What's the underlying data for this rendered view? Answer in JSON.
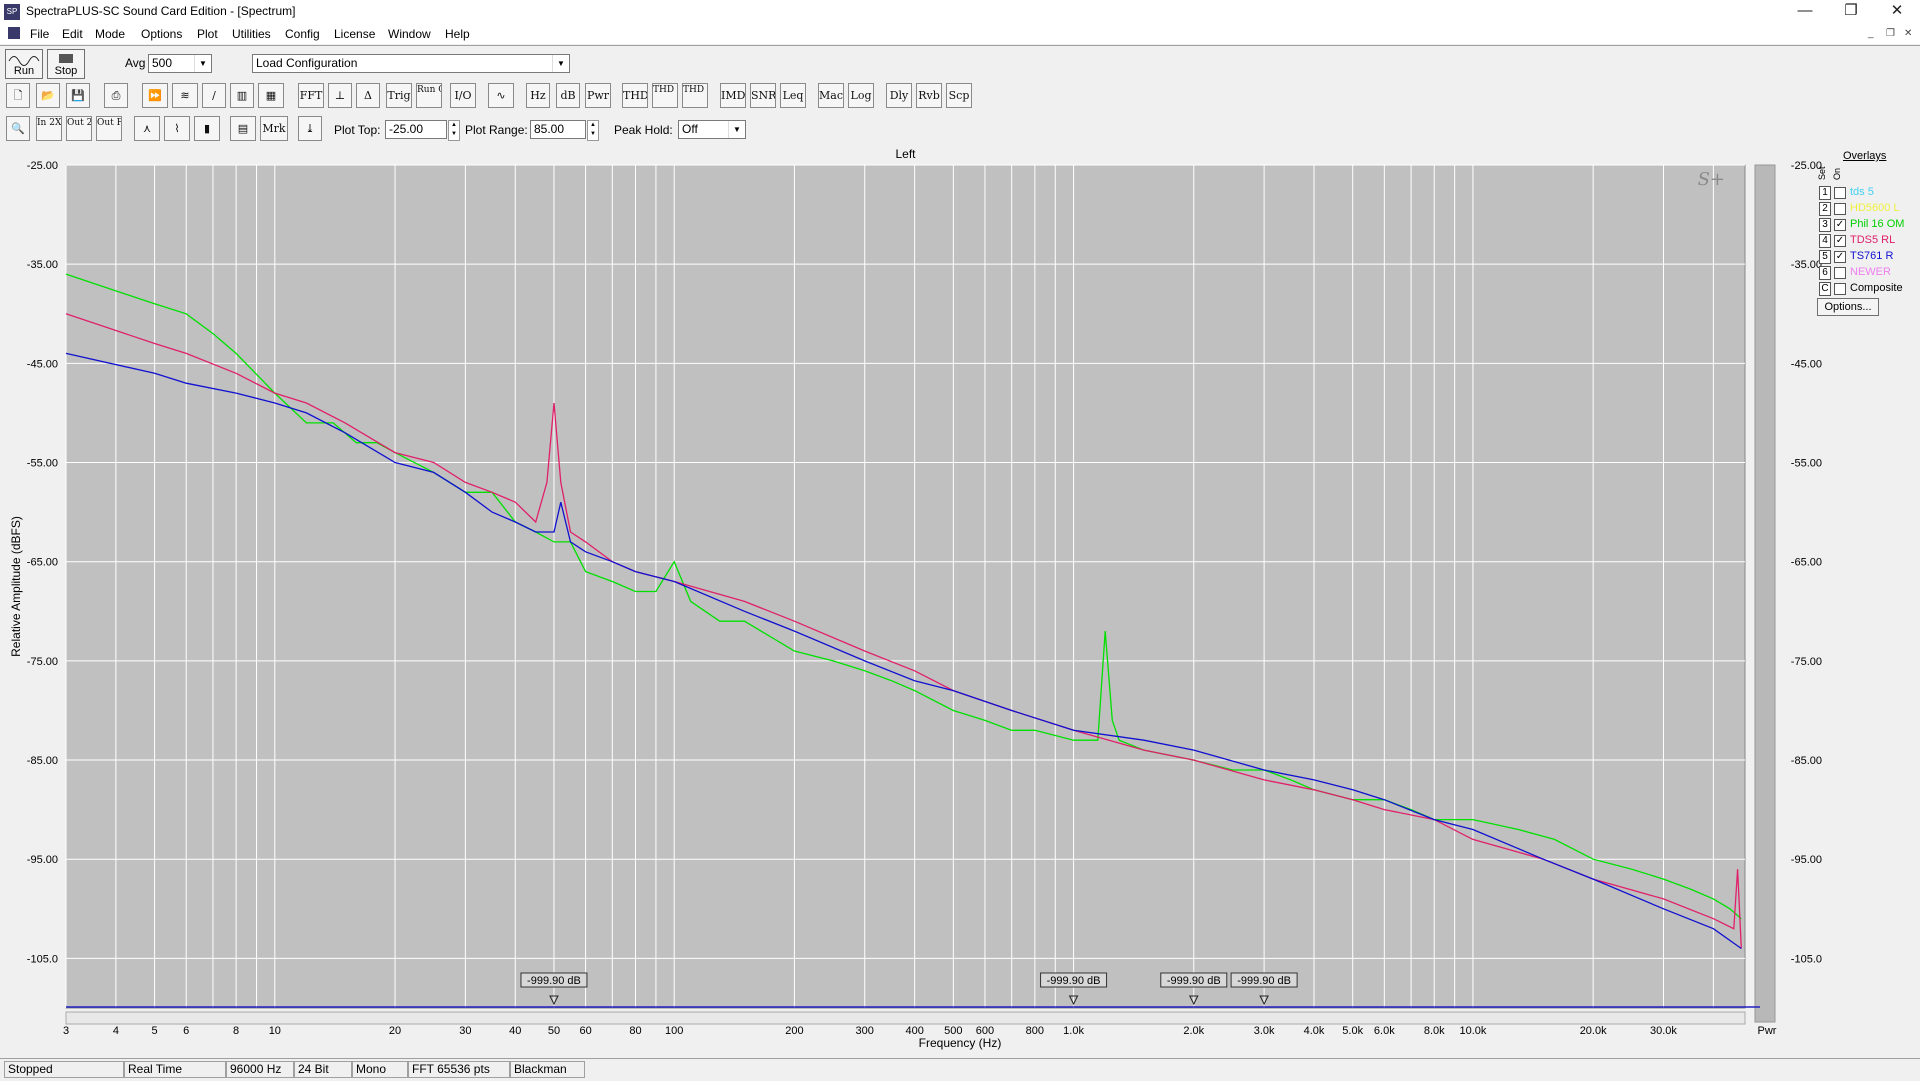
{
  "window": {
    "title": "SpectraPLUS-SC Sound Card Edition - [Spectrum]",
    "app_icon_text": "SP",
    "minimize": "—",
    "restore": "❐",
    "close": "✕"
  },
  "menu": [
    "File",
    "Edit",
    "Mode",
    "Options",
    "Plot",
    "Utilities",
    "Config",
    "License",
    "Window",
    "Help"
  ],
  "mdi_controls": [
    "_",
    "❐",
    "✕"
  ],
  "toolbar": {
    "run_label": "Run",
    "stop_label": "Stop",
    "avg_label": "Avg",
    "avg_value": "500",
    "config_value": "Load Configuration",
    "plot_top_label": "Plot Top:",
    "plot_top_value": "-25.00",
    "plot_range_label": "Plot Range:",
    "plot_range_value": "85.00",
    "peak_hold_label": "Peak Hold:",
    "peak_hold_value": "Off",
    "row2_buttons": [
      "FFT",
      "Trig",
      "Run Ctrl",
      "I/O",
      "Hz",
      "dB",
      "Pwr",
      "THD",
      "THD +N",
      "THD Freq",
      "IMD",
      "SNR",
      "Leq",
      "Mac",
      "Log",
      "Dly",
      "Rvb",
      "Scp"
    ],
    "row3_buttons": [
      "Mrk"
    ],
    "zoom_buttons": [
      "In 2X",
      "Out 2X",
      "Out Full"
    ]
  },
  "plot": {
    "channel_title": "Left",
    "watermark": "S+",
    "y_axis_label": "Relative Amplitude (dBFS)",
    "x_axis_label": "Frequency (Hz)",
    "right_axis_unit": "Pwr",
    "y_ticks": [
      "-25.00",
      "-35.00",
      "-45.00",
      "-55.00",
      "-65.00",
      "-75.00",
      "-85.00",
      "-95.00",
      "-105.0"
    ],
    "x_ticks": [
      "3",
      "4",
      "5",
      "6",
      "8",
      "10",
      "20",
      "30",
      "40",
      "50",
      "60",
      "80",
      "100",
      "200",
      "300",
      "400",
      "500",
      "600",
      "800",
      "1.0k",
      "2.0k",
      "3.0k",
      "4.0k",
      "5.0k",
      "6.0k",
      "8.0k",
      "10.0k",
      "20.0k",
      "30.0k"
    ],
    "markers": [
      "-999.90 dB",
      "-999.90 dB",
      "-999.90 dB",
      "-999.90 dB"
    ],
    "colors": {
      "plot_bg": "#c0c0c0",
      "grid": "#ffffff",
      "green": "#00e000",
      "pink": "#e0206a",
      "blue": "#1010d0"
    }
  },
  "overlays": {
    "header": "Overlays",
    "set_label": "Set",
    "on_label": "On",
    "items": [
      {
        "num": "1",
        "name": "tds 5",
        "checked": false,
        "color": "#40d0f0"
      },
      {
        "num": "2",
        "name": "HD5600 L",
        "checked": false,
        "color": "#f0f040"
      },
      {
        "num": "3",
        "name": "Phil 16 OM",
        "checked": true,
        "color": "#00d000"
      },
      {
        "num": "4",
        "name": "TDS5 RL",
        "checked": true,
        "color": "#e0206a"
      },
      {
        "num": "5",
        "name": "TS761 R",
        "checked": true,
        "color": "#1010d0"
      },
      {
        "num": "6",
        "name": "NEWER",
        "checked": false,
        "color": "#f080f0"
      },
      {
        "num": "C",
        "name": "Composite",
        "checked": false,
        "color": "#000000"
      }
    ],
    "options_label": "Options..."
  },
  "chart_data": {
    "type": "line",
    "title": "Left",
    "xlabel": "Frequency (Hz)",
    "ylabel": "Relative Amplitude (dBFS)",
    "x_scale": "log",
    "xlim": [
      3,
      48000
    ],
    "ylim": [
      -110,
      -25
    ],
    "grid": true,
    "legend_position": "right",
    "series": [
      {
        "name": "Phil 16 OM",
        "color": "#00e000",
        "x": [
          3,
          5,
          6,
          7,
          8,
          10,
          12,
          14,
          16,
          18,
          20,
          25,
          30,
          35,
          40,
          45,
          50,
          55,
          60,
          70,
          80,
          90,
          100,
          110,
          130,
          150,
          200,
          250,
          300,
          350,
          400,
          500,
          600,
          700,
          800,
          1000,
          1150,
          1200,
          1250,
          1300,
          1500,
          2000,
          2500,
          3000,
          3500,
          4000,
          5000,
          6000,
          7000,
          8000,
          10000,
          13000,
          16000,
          20000,
          25000,
          30000,
          35000,
          40000,
          44000,
          47000
        ],
        "y": [
          -36,
          -39,
          -40,
          -42,
          -44,
          -48,
          -51,
          -51,
          -53,
          -53,
          -54,
          -56,
          -58,
          -58,
          -61,
          -62,
          -63,
          -63,
          -66,
          -67,
          -68,
          -68,
          -65,
          -69,
          -71,
          -71,
          -74,
          -75,
          -76,
          -77,
          -78,
          -80,
          -81,
          -82,
          -82,
          -83,
          -83,
          -72,
          -81,
          -83,
          -84,
          -85,
          -86,
          -86,
          -87,
          -88,
          -89,
          -89,
          -90,
          -91,
          -91,
          -92,
          -93,
          -95,
          -96,
          -97,
          -98,
          -99,
          -100,
          -101
        ]
      },
      {
        "name": "TDS5 RL",
        "color": "#e0206a",
        "x": [
          3,
          5,
          6,
          8,
          10,
          12,
          15,
          20,
          25,
          30,
          35,
          40,
          45,
          48,
          50,
          52,
          55,
          60,
          70,
          80,
          100,
          150,
          200,
          300,
          400,
          500,
          700,
          1000,
          1500,
          2000,
          3000,
          4000,
          5000,
          6000,
          8000,
          10000,
          15000,
          20000,
          30000,
          40000,
          45000,
          46000,
          47000
        ],
        "y": [
          -40,
          -43,
          -44,
          -46,
          -48,
          -49,
          -51,
          -54,
          -55,
          -57,
          -58,
          -59,
          -61,
          -57,
          -49,
          -57,
          -62,
          -63,
          -65,
          -66,
          -67,
          -69,
          -71,
          -74,
          -76,
          -78,
          -80,
          -82,
          -84,
          -85,
          -87,
          -88,
          -89,
          -90,
          -91,
          -93,
          -95,
          -97,
          -99,
          -101,
          -102,
          -96,
          -104
        ]
      },
      {
        "name": "TS761 R",
        "color": "#1010d0",
        "x": [
          3,
          5,
          6,
          8,
          10,
          12,
          15,
          20,
          25,
          30,
          35,
          40,
          45,
          50,
          52,
          55,
          60,
          70,
          80,
          100,
          150,
          200,
          300,
          400,
          500,
          700,
          1000,
          1500,
          2000,
          3000,
          4000,
          5000,
          6000,
          8000,
          10000,
          15000,
          20000,
          30000,
          40000,
          47000
        ],
        "y": [
          -44,
          -46,
          -47,
          -48,
          -49,
          -50,
          -52,
          -55,
          -56,
          -58,
          -60,
          -61,
          -62,
          -62,
          -59,
          -63,
          -64,
          -65,
          -66,
          -67,
          -70,
          -72,
          -75,
          -77,
          -78,
          -80,
          -82,
          -83,
          -84,
          -86,
          -87,
          -88,
          -89,
          -91,
          -92,
          -95,
          -97,
          -100,
          -102,
          -104
        ]
      }
    ]
  }
}
